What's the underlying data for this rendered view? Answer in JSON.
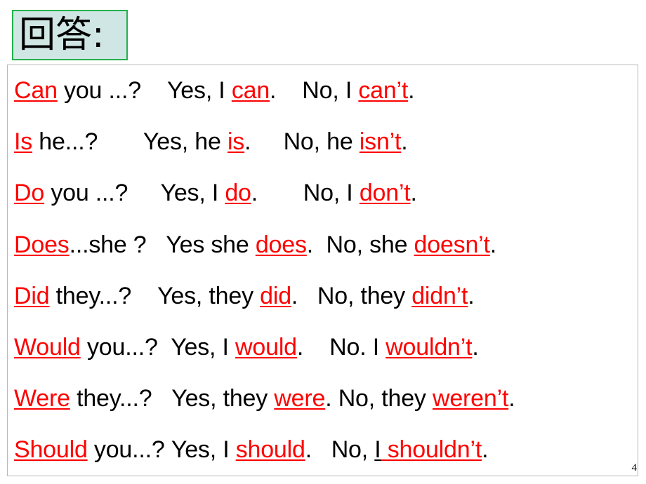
{
  "slide": {
    "title": "回答:",
    "page_number": "4",
    "accent_red": "#ff0000",
    "title_box_fill": "#cfe6e4",
    "title_box_border": "#24b14c",
    "content_box_border": "#b7b7b7"
  },
  "rows": [
    {
      "id": "can",
      "question": {
        "aux": "Can",
        "rest": " you ...?"
      },
      "affirmative": {
        "lead": "Yes, I ",
        "verb": "can",
        "tail": "."
      },
      "negative": {
        "lead": "No, I ",
        "verb": "can’t",
        "tail": "."
      },
      "gap1": "    ",
      "gap2": "    "
    },
    {
      "id": "is",
      "question": {
        "aux": "Is",
        "rest": " he...?"
      },
      "affirmative": {
        "lead": "Yes, he ",
        "verb": "is",
        "tail": "."
      },
      "negative": {
        "lead": "No, he ",
        "verb": "isn’t",
        "tail": "."
      },
      "gap1": "       ",
      "gap2": "     "
    },
    {
      "id": "do",
      "question": {
        "aux": "Do",
        "rest": " you ...?"
      },
      "affirmative": {
        "lead": "Yes, I ",
        "verb": "do",
        "tail": "."
      },
      "negative": {
        "lead": "No, I ",
        "verb": "don’t",
        "tail": "."
      },
      "gap1": "     ",
      "gap2": "       "
    },
    {
      "id": "does",
      "question": {
        "aux": "Does",
        "rest": "...she ?"
      },
      "affirmative": {
        "lead": "Yes she ",
        "verb": "does",
        "tail": "."
      },
      "negative": {
        "lead": "No, she ",
        "verb": "doesn’t",
        "tail": "."
      },
      "gap1": "   ",
      "gap2": "  "
    },
    {
      "id": "did",
      "question": {
        "aux": "Did",
        "rest": " they...?"
      },
      "affirmative": {
        "lead": "Yes, they ",
        "verb": "did",
        "tail": "."
      },
      "negative": {
        "lead": "No, they ",
        "verb": "didn’t",
        "tail": "."
      },
      "gap1": "    ",
      "gap2": "   "
    },
    {
      "id": "would",
      "question": {
        "aux": "Would",
        "rest": " you...?"
      },
      "affirmative": {
        "lead": "Yes, I ",
        "verb": "would",
        "tail": "."
      },
      "negative": {
        "lead": "No. I ",
        "verb": "wouldn’t",
        "tail": "."
      },
      "gap1": "  ",
      "gap2": "    "
    },
    {
      "id": "were",
      "question": {
        "aux": "Were",
        "rest": " they...?"
      },
      "affirmative": {
        "lead": "Yes, they ",
        "verb": "were",
        "tail": "."
      },
      "negative": {
        "lead": "No, they ",
        "verb": "weren’t",
        "tail": "."
      },
      "gap1": "   ",
      "gap2": " "
    },
    {
      "id": "should",
      "question": {
        "aux": "Should",
        "rest": " you...?"
      },
      "affirmative": {
        "lead": "Yes, I ",
        "verb": "should",
        "tail": "."
      },
      "negative": {
        "lead": "No, ",
        "subject": "I",
        "verb": " shouldn’t",
        "tail": "."
      },
      "gap1": " ",
      "gap2": "   "
    }
  ]
}
